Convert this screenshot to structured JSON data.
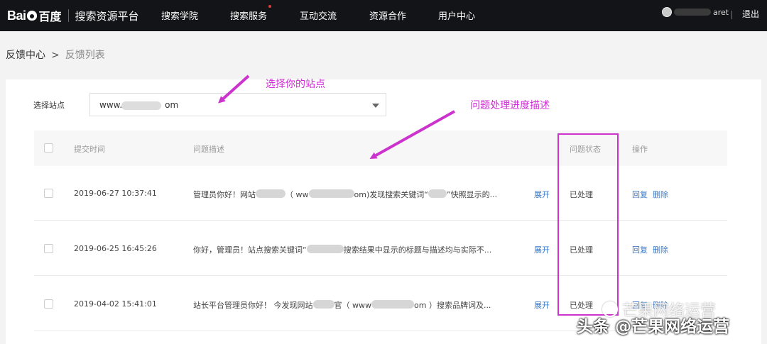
{
  "header": {
    "logo_bai": "Bai",
    "logo_du": "百度",
    "platform": "搜索资源平台",
    "nav": [
      "搜索学院",
      "搜索服务",
      "互动交流",
      "资源合作",
      "用户中心"
    ],
    "username_suffix": "aret",
    "logout": "退出"
  },
  "breadcrumb": {
    "root": "反馈中心",
    "separator": ">",
    "current": "反馈列表"
  },
  "site_select": {
    "label": "选择站点",
    "value_prefix": "www.",
    "value_suffix": "om"
  },
  "table": {
    "headers": {
      "time": "提交时间",
      "desc": "问题描述",
      "status": "问题状态",
      "ops": "操作"
    },
    "rows": [
      {
        "time": "2019-06-27 10:37:41",
        "desc_a": "管理员你好！网站",
        "desc_b": "（ ww",
        "desc_c": "om)发现搜索关键词“",
        "desc_d": "”快照显示的...",
        "expand": "展开",
        "status": "已处理",
        "reply": "回复",
        "delete": "删除"
      },
      {
        "time": "2019-06-25 16:45:26",
        "desc_a": "你好，管理员！站点搜索关键词“",
        "desc_b": "搜索结果中显示的标题与描述均与实际不...",
        "expand": "展开",
        "status": "已处理",
        "reply": "回复",
        "delete": "删除"
      },
      {
        "time": "2019-04-02 15:41:01",
        "desc_a": "站长平台管理员你好！ 今发现网站",
        "desc_b": "官（ www",
        "desc_c": "om ）搜索品牌词及...",
        "expand": "展开",
        "status": "已处理",
        "reply": "回复",
        "delete": "删除"
      }
    ]
  },
  "annotations": {
    "select_site": "选择你的站点",
    "progress_desc": "问题处理进度描述"
  },
  "watermark": {
    "faint": "芒果网络运营",
    "main": "头条 @芒果网络运营"
  },
  "colors": {
    "topbar": "#121418",
    "link": "#3a7ac8",
    "annotation": "#d02ad6"
  }
}
